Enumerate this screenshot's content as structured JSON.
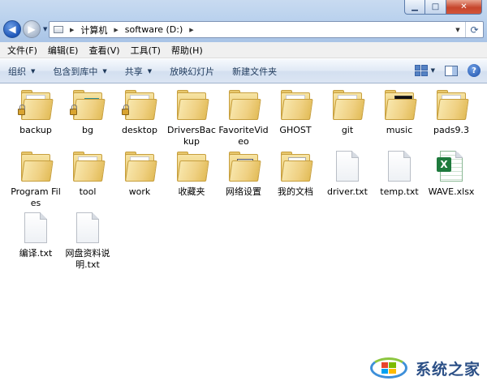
{
  "window": {
    "controls": [
      "minimize",
      "maximize",
      "close"
    ]
  },
  "address": {
    "crumbs": [
      "计算机",
      "software (D:)"
    ],
    "icon": "computer-icon"
  },
  "menubar": [
    "文件(F)",
    "编辑(E)",
    "查看(V)",
    "工具(T)",
    "帮助(H)"
  ],
  "commandbar": {
    "organize": "组织",
    "include_library": "包含到库中",
    "share": "共享",
    "slideshow": "放映幻灯片",
    "new_folder": "新建文件夹"
  },
  "items": [
    {
      "label": "backup",
      "kind": "folder",
      "variant": "lock"
    },
    {
      "label": "bg",
      "kind": "folder",
      "variant": "lock-teal"
    },
    {
      "label": "desktop",
      "kind": "folder",
      "variant": "lock"
    },
    {
      "label": "DriversBackup",
      "kind": "folder",
      "variant": "plain"
    },
    {
      "label": "FavoriteVideo",
      "kind": "folder",
      "variant": "plain"
    },
    {
      "label": "GHOST",
      "kind": "folder",
      "variant": "paper"
    },
    {
      "label": "git",
      "kind": "folder",
      "variant": "paper"
    },
    {
      "label": "music",
      "kind": "folder",
      "variant": "music"
    },
    {
      "label": "pads9.3",
      "kind": "folder",
      "variant": "paper"
    },
    {
      "label": "Program Files",
      "kind": "folder",
      "variant": "plain"
    },
    {
      "label": "tool",
      "kind": "folder",
      "variant": "paper"
    },
    {
      "label": "work",
      "kind": "folder",
      "variant": "paper"
    },
    {
      "label": "收藏夹",
      "kind": "folder",
      "variant": "plain"
    },
    {
      "label": "网络设置",
      "kind": "folder",
      "variant": "net"
    },
    {
      "label": "我的文档",
      "kind": "folder",
      "variant": "doc"
    },
    {
      "label": "driver.txt",
      "kind": "file"
    },
    {
      "label": "temp.txt",
      "kind": "file"
    },
    {
      "label": "WAVE.xlsx",
      "kind": "xlsx"
    },
    {
      "label": "编译.txt",
      "kind": "file"
    },
    {
      "label": "网盘资料说明.txt",
      "kind": "file"
    }
  ],
  "watermark": {
    "text": "系统之家"
  }
}
